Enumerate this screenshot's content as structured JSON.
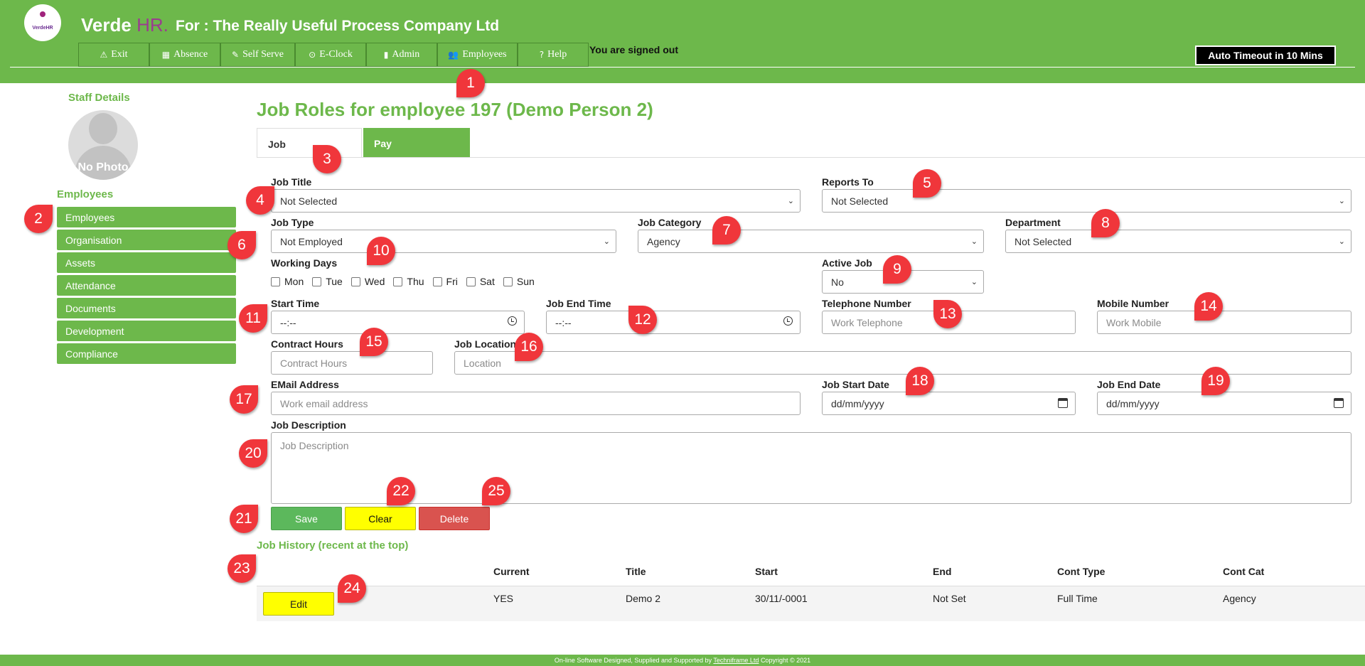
{
  "app": {
    "brand_main": "Verde",
    "brand_hr": "HR.",
    "logo_text": "VerdeHR",
    "company": "For : The Really Useful Process Company Ltd",
    "signed_status": "You are signed out",
    "timeout": "Auto Timeout in 10 Mins"
  },
  "nav": [
    {
      "label": "Exit",
      "icon": "warning-icon",
      "glyph": "⚠"
    },
    {
      "label": "Absence",
      "icon": "calendar-icon",
      "glyph": "▦"
    },
    {
      "label": "Self Serve",
      "icon": "pencil-icon",
      "glyph": "✎"
    },
    {
      "label": "E-Clock",
      "icon": "clock-icon",
      "glyph": "⊙"
    },
    {
      "label": "Admin",
      "icon": "building-icon",
      "glyph": "▮"
    },
    {
      "label": "Employees",
      "icon": "users-icon",
      "glyph": "👥"
    },
    {
      "label": "Help",
      "icon": "question-icon",
      "glyph": "?"
    }
  ],
  "sidebar": {
    "staff_details": "Staff Details",
    "no_photo": "No Photo",
    "section": "Employees",
    "items": [
      "Employees",
      "Organisation",
      "Assets",
      "Attendance",
      "Documents",
      "Development",
      "Compliance"
    ]
  },
  "page": {
    "title": "Job Roles for employee 197 (Demo Person 2)",
    "tabs": [
      "Job",
      "Pay"
    ]
  },
  "form": {
    "job_title": {
      "label": "Job Title",
      "value": "Not Selected"
    },
    "reports_to": {
      "label": "Reports To",
      "value": "Not Selected"
    },
    "job_type": {
      "label": "Job Type",
      "value": "Not Employed"
    },
    "job_category": {
      "label": "Job Category",
      "value": "Agency"
    },
    "department": {
      "label": "Department",
      "value": "Not Selected"
    },
    "working_days": {
      "label": "Working Days",
      "days": [
        "Mon",
        "Tue",
        "Wed",
        "Thu",
        "Fri",
        "Sat",
        "Sun"
      ]
    },
    "active_job": {
      "label": "Active Job",
      "value": "No"
    },
    "start_time": {
      "label": "Start Time",
      "value": "--:--"
    },
    "end_time": {
      "label": "Job End Time",
      "value": "--:--"
    },
    "telephone": {
      "label": "Telephone Number",
      "placeholder": "Work Telephone"
    },
    "mobile": {
      "label": "Mobile Number",
      "placeholder": "Work Mobile"
    },
    "contract_hours": {
      "label": "Contract Hours",
      "placeholder": "Contract Hours"
    },
    "location": {
      "label": "Job Location",
      "placeholder": "Location"
    },
    "email": {
      "label": "EMail Address",
      "placeholder": "Work email address"
    },
    "start_date": {
      "label": "Job Start Date",
      "value": "dd/mm/yyyy"
    },
    "end_date": {
      "label": "Job End Date",
      "value": "dd/mm/yyyy"
    },
    "description": {
      "label": "Job Description",
      "placeholder": "Job Description"
    },
    "save": "Save",
    "clear": "Clear",
    "delete": "Delete"
  },
  "history": {
    "title": "Job History (recent at the top)",
    "headers": [
      "Current",
      "Title",
      "Start",
      "End",
      "Cont Type",
      "Cont Cat"
    ],
    "rows": [
      {
        "edit": "Edit",
        "current": "YES",
        "title": "Demo 2",
        "start": "30/11/-0001",
        "end": "Not Set",
        "cont_type": "Full Time",
        "cont_cat": "Agency"
      }
    ]
  },
  "footer": {
    "prefix": "On-line Software Designed, Supplied and Supported by",
    "link": "Techniframe Ltd",
    "suffix": "Copyright © 2021"
  },
  "markers": [
    "1",
    "2",
    "3",
    "4",
    "5",
    "6",
    "7",
    "8",
    "9",
    "10",
    "11",
    "12",
    "13",
    "14",
    "15",
    "16",
    "17",
    "18",
    "19",
    "20",
    "21",
    "22",
    "23",
    "24",
    "25"
  ],
  "colors": {
    "brand_green": "#6db84b",
    "marker_red": "#f0363b",
    "save_green": "#5cb85c",
    "clear_yellow": "#ffff00",
    "delete_red": "#d9534f"
  }
}
